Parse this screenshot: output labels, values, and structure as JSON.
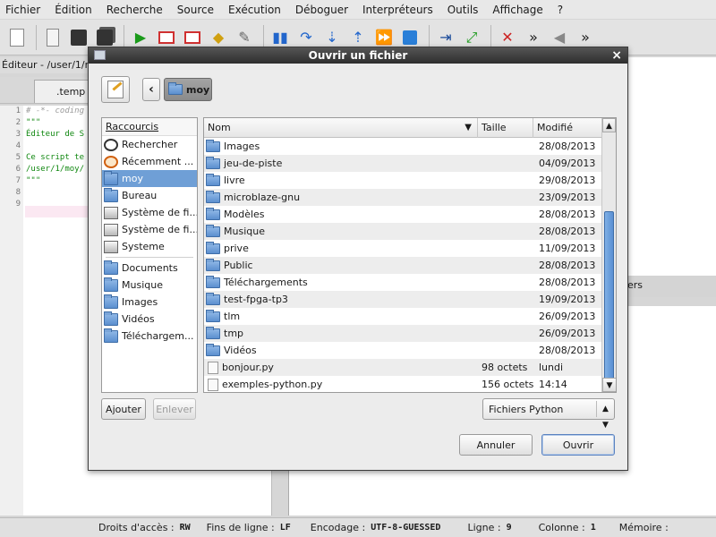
{
  "menubar": {
    "items": [
      "Fichier",
      "Édition",
      "Recherche",
      "Source",
      "Exécution",
      "Déboguer",
      "Interpréteurs",
      "Outils",
      "Affichage",
      "?"
    ]
  },
  "editor": {
    "title": "Éditeur - /user/1/m",
    "tab_label": ".temp",
    "line_numbers": [
      "1",
      "2",
      "3",
      "4",
      "5",
      "6",
      "7",
      "8",
      "9"
    ],
    "code_lines": [
      {
        "text": "# -*- coding",
        "kind": "comment"
      },
      {
        "text": "\"\"\"",
        "kind": "str"
      },
      {
        "text": "Éditeur de S",
        "kind": "str"
      },
      {
        "text": "",
        "kind": "str"
      },
      {
        "text": "Ce script te",
        "kind": "str"
      },
      {
        "text": "/user/1/moy/",
        "kind": "str"
      },
      {
        "text": "\"\"\"",
        "kind": "str"
      },
      {
        "text": "",
        "kind": "plain"
      },
      {
        "text": "",
        "kind": "plain"
      }
    ]
  },
  "right_panel": {
    "tab_fragment": "ers"
  },
  "statusbar": {
    "access_label": "Droits d'accès :",
    "access_value": "RW",
    "eol_label": "Fins de ligne :",
    "eol_value": "LF",
    "encoding_label": "Encodage :",
    "encoding_value": "UTF-8-GUESSED",
    "line_label": "Ligne :",
    "line_value": "9",
    "column_label": "Colonne :",
    "column_value": "1",
    "memory_label": "Mémoire :"
  },
  "dialog": {
    "title": "Ouvrir un fichier",
    "close_glyph": "×",
    "back_glyph": "‹",
    "current_folder": "moy",
    "places_header": "Raccourcis",
    "places": [
      {
        "label": "Rechercher",
        "icon": "search-icon"
      },
      {
        "label": "Récemment ...",
        "icon": "recent-icon"
      },
      {
        "label": "moy",
        "icon": "home-folder-icon",
        "selected": true
      },
      {
        "label": "Bureau",
        "icon": "folder-icon"
      },
      {
        "label": "Système de fi...",
        "icon": "drive-icon"
      },
      {
        "label": "Système de fi...",
        "icon": "drive-icon"
      },
      {
        "label": "Systeme",
        "icon": "drive-icon"
      }
    ],
    "bookmarks": [
      {
        "label": "Documents",
        "icon": "folder-icon"
      },
      {
        "label": "Musique",
        "icon": "folder-icon"
      },
      {
        "label": "Images",
        "icon": "folder-icon"
      },
      {
        "label": "Vidéos",
        "icon": "folder-icon"
      },
      {
        "label": "Téléchargem...",
        "icon": "folder-icon"
      }
    ],
    "columns": {
      "name": "Nom",
      "size": "Taille",
      "modified": "Modifié"
    },
    "files": [
      {
        "name": "Images",
        "size": "",
        "modified": "28/08/2013",
        "type": "folder"
      },
      {
        "name": "jeu-de-piste",
        "size": "",
        "modified": "04/09/2013",
        "type": "folder"
      },
      {
        "name": "livre",
        "size": "",
        "modified": "29/08/2013",
        "type": "folder"
      },
      {
        "name": "microblaze-gnu",
        "size": "",
        "modified": "23/09/2013",
        "type": "folder"
      },
      {
        "name": "Modèles",
        "size": "",
        "modified": "28/08/2013",
        "type": "folder"
      },
      {
        "name": "Musique",
        "size": "",
        "modified": "28/08/2013",
        "type": "folder"
      },
      {
        "name": "prive",
        "size": "",
        "modified": "11/09/2013",
        "type": "folder"
      },
      {
        "name": "Public",
        "size": "",
        "modified": "28/08/2013",
        "type": "folder"
      },
      {
        "name": "Téléchargements",
        "size": "",
        "modified": "28/08/2013",
        "type": "folder"
      },
      {
        "name": "test-fpga-tp3",
        "size": "",
        "modified": "19/09/2013",
        "type": "folder"
      },
      {
        "name": "tlm",
        "size": "",
        "modified": "26/09/2013",
        "type": "folder"
      },
      {
        "name": "tmp",
        "size": "",
        "modified": "26/09/2013",
        "type": "folder"
      },
      {
        "name": "Vidéos",
        "size": "",
        "modified": "28/08/2013",
        "type": "folder"
      },
      {
        "name": "bonjour.py",
        "size": "98 octets",
        "modified": "lundi",
        "type": "file"
      },
      {
        "name": "exemples-python.py",
        "size": "156 octets",
        "modified": "14:14",
        "type": "file"
      }
    ],
    "add_button": "Ajouter",
    "remove_button": "Enlever",
    "filter": "Fichiers Python",
    "cancel_button": "Annuler",
    "open_button": "Ouvrir"
  }
}
